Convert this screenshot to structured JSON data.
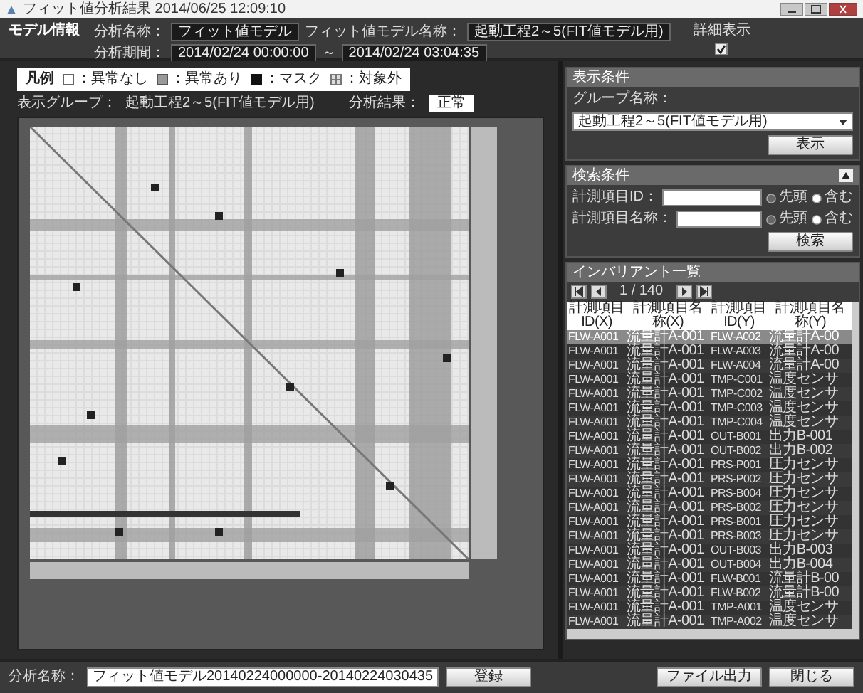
{
  "window": {
    "title": "フィット値分析結果 2014/06/25 12:09:10"
  },
  "model_info": {
    "heading": "モデル情報",
    "analysis_name_label": "分析名称：",
    "analysis_name": "フィット値モデル",
    "model_name_label": "フィット値モデル名称：",
    "model_name": "起動工程2～5(FIT値モデル用)",
    "period_label": "分析期間：",
    "period_start": "2014/02/24 00:00:00",
    "period_sep": "～",
    "period_end": "2014/02/24 03:04:35"
  },
  "detail_toggle": {
    "label": "詳細表示",
    "checked": true
  },
  "legend": {
    "title": "凡例",
    "items": [
      {
        "kind": "normal",
        "label": "：異常なし"
      },
      {
        "kind": "abnormal",
        "label": "：異常あり"
      },
      {
        "kind": "mask",
        "label": "：マスク"
      },
      {
        "kind": "excluded",
        "label": "：対象外"
      }
    ]
  },
  "group_info": {
    "group_label": "表示グループ：",
    "group": "起動工程2～5(FIT値モデル用)",
    "result_label": "分析結果：",
    "result": "正常"
  },
  "display_conditions": {
    "title": "表示条件",
    "group_label": "グループ名称：",
    "group_value": "起動工程2～5(FIT値モデル用)",
    "button": "表示"
  },
  "search_conditions": {
    "title": "検索条件",
    "expanded": true,
    "button": "検索",
    "fields": [
      {
        "label": "計測項目ID：",
        "options": [
          {
            "label": "先頭",
            "selected": false
          },
          {
            "label": "含む",
            "selected": true
          }
        ]
      },
      {
        "label": "計測項目名称：",
        "options": [
          {
            "label": "先頭",
            "selected": false
          },
          {
            "label": "含む",
            "selected": true
          }
        ]
      }
    ]
  },
  "invariants": {
    "title": "インバリアント一覧",
    "page": "1 / 140",
    "columns": [
      "計測項目ID(X)",
      "計測項目名称(X)",
      "計測項目ID(Y)",
      "計測項目名称(Y)"
    ],
    "rows": [
      {
        "cells": [
          "FLW-A001",
          "流量計A-001",
          "FLW-A002",
          "流量計A-00"
        ],
        "selected": true
      },
      {
        "cells": [
          "FLW-A001",
          "流量計A-001",
          "FLW-A003",
          "流量計A-00"
        ],
        "selected": false
      },
      {
        "cells": [
          "FLW-A001",
          "流量計A-001",
          "FLW-A004",
          "流量計A-00"
        ],
        "selected": false
      },
      {
        "cells": [
          "FLW-A001",
          "流量計A-001",
          "TMP-C001",
          "温度センサ"
        ],
        "selected": false
      },
      {
        "cells": [
          "FLW-A001",
          "流量計A-001",
          "TMP-C002",
          "温度センサ"
        ],
        "selected": false
      },
      {
        "cells": [
          "FLW-A001",
          "流量計A-001",
          "TMP-C003",
          "温度センサ"
        ],
        "selected": false
      },
      {
        "cells": [
          "FLW-A001",
          "流量計A-001",
          "TMP-C004",
          "温度センサ"
        ],
        "selected": false
      },
      {
        "cells": [
          "FLW-A001",
          "流量計A-001",
          "OUT-B001",
          "出力B-001"
        ],
        "selected": false
      },
      {
        "cells": [
          "FLW-A001",
          "流量計A-001",
          "OUT-B002",
          "出力B-002"
        ],
        "selected": false
      },
      {
        "cells": [
          "FLW-A001",
          "流量計A-001",
          "PRS-P001",
          "圧力センサ"
        ],
        "selected": false
      },
      {
        "cells": [
          "FLW-A001",
          "流量計A-001",
          "PRS-P002",
          "圧力センサ"
        ],
        "selected": false
      },
      {
        "cells": [
          "FLW-A001",
          "流量計A-001",
          "PRS-B004",
          "圧力センサ"
        ],
        "selected": false
      },
      {
        "cells": [
          "FLW-A001",
          "流量計A-001",
          "PRS-B002",
          "圧力センサ"
        ],
        "selected": false
      },
      {
        "cells": [
          "FLW-A001",
          "流量計A-001",
          "PRS-B001",
          "圧力センサ"
        ],
        "selected": false
      },
      {
        "cells": [
          "FLW-A001",
          "流量計A-001",
          "PRS-B003",
          "圧力センサ"
        ],
        "selected": false
      },
      {
        "cells": [
          "FLW-A001",
          "流量計A-001",
          "OUT-B003",
          "出力B-003"
        ],
        "selected": false
      },
      {
        "cells": [
          "FLW-A001",
          "流量計A-001",
          "OUT-B004",
          "出力B-004"
        ],
        "selected": false
      },
      {
        "cells": [
          "FLW-A001",
          "流量計A-001",
          "FLW-B001",
          "流量計B-00"
        ],
        "selected": false
      },
      {
        "cells": [
          "FLW-A001",
          "流量計A-001",
          "FLW-B002",
          "流量計B-00"
        ],
        "selected": false
      },
      {
        "cells": [
          "FLW-A001",
          "流量計A-001",
          "TMP-A001",
          "温度センサ"
        ],
        "selected": false
      },
      {
        "cells": [
          "FLW-A001",
          "流量計A-001",
          "TMP-A002",
          "温度センサ"
        ],
        "selected": false
      }
    ]
  },
  "footer": {
    "name_label": "分析名称：",
    "name_value": "フィット値モデル20140224000000-20140224030435",
    "register_button": "登録",
    "export_button": "ファイル出力",
    "close_button": "閉じる"
  }
}
